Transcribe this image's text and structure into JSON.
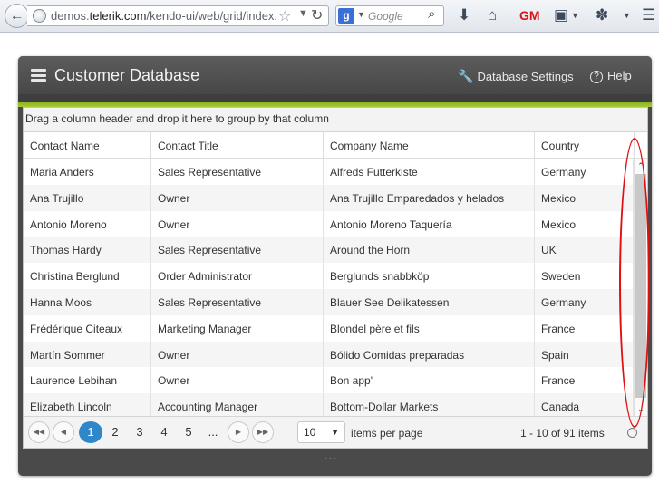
{
  "browser": {
    "url_prefix": "demos.",
    "url_domain": "telerik.com",
    "url_suffix": "/kendo-ui/web/grid/index.h",
    "search_placeholder": "Google",
    "search_engine_letter": "g"
  },
  "app": {
    "title": "Customer Database",
    "settings_label": "Database Settings",
    "help_label": "Help"
  },
  "grid": {
    "group_hint": "Drag a column header and drop it here to group by that column",
    "columns": [
      "Contact Name",
      "Contact Title",
      "Company Name",
      "Country"
    ],
    "rows": [
      [
        "Maria Anders",
        "Sales Representative",
        "Alfreds Futterkiste",
        "Germany"
      ],
      [
        "Ana Trujillo",
        "Owner",
        "Ana Trujillo Emparedados y helados",
        "Mexico"
      ],
      [
        "Antonio Moreno",
        "Owner",
        "Antonio Moreno Taquería",
        "Mexico"
      ],
      [
        "Thomas Hardy",
        "Sales Representative",
        "Around the Horn",
        "UK"
      ],
      [
        "Christina Berglund",
        "Order Administrator",
        "Berglunds snabbköp",
        "Sweden"
      ],
      [
        "Hanna Moos",
        "Sales Representative",
        "Blauer See Delikatessen",
        "Germany"
      ],
      [
        "Frédérique Citeaux",
        "Marketing Manager",
        "Blondel père et fils",
        "France"
      ],
      [
        "Martín Sommer",
        "Owner",
        "Bólido Comidas preparadas",
        "Spain"
      ],
      [
        "Laurence Lebihan",
        "Owner",
        "Bon app'",
        "France"
      ],
      [
        "Elizabeth Lincoln",
        "Accounting Manager",
        "Bottom-Dollar Markets",
        "Canada"
      ]
    ]
  },
  "pager": {
    "pages": [
      "1",
      "2",
      "3",
      "4",
      "5",
      "..."
    ],
    "current_page": "1",
    "page_size": "10",
    "items_per_page_label": "items per page",
    "info": "1 - 10 of 91 items"
  },
  "colors": {
    "accent_green": "#8cb224",
    "pager_selected": "#2f86c9",
    "annotation_red": "#e01010"
  }
}
